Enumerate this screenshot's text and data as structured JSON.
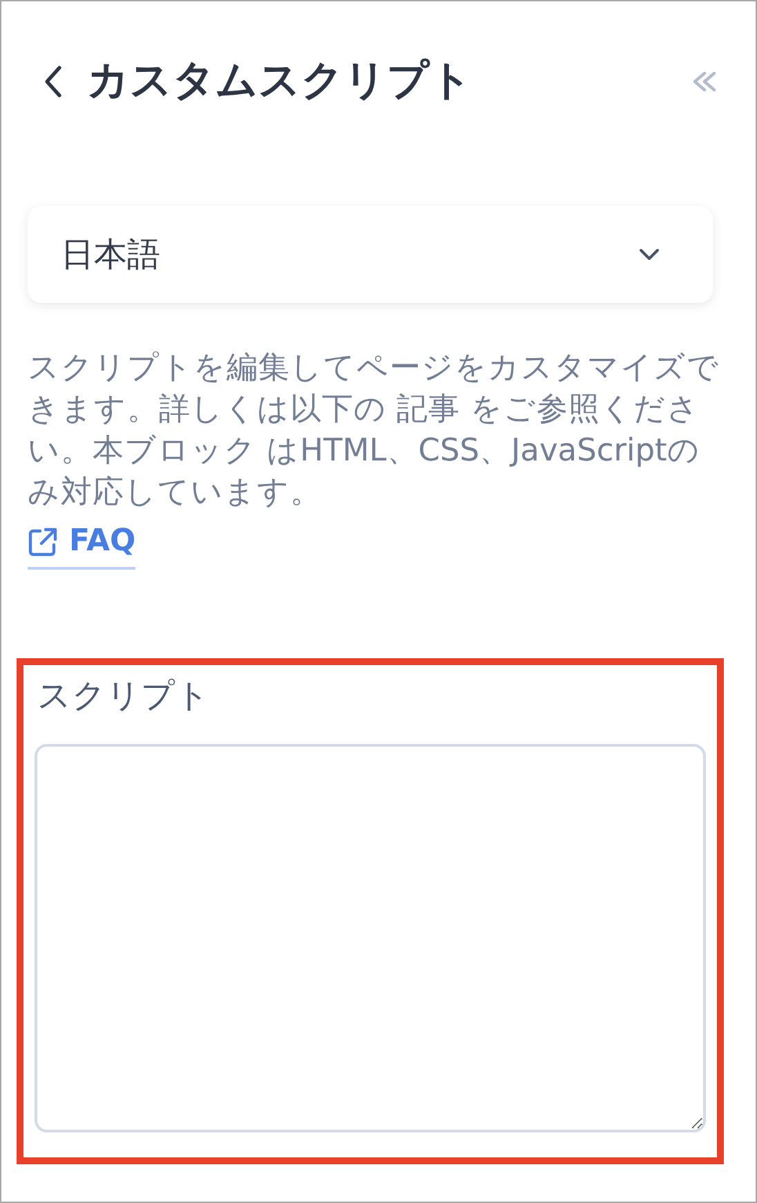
{
  "header": {
    "title": "カスタムスクリプト"
  },
  "language_select": {
    "value": "日本語"
  },
  "description": "スクリプトを編集してページをカスタマイズできます。詳しくは以下の 記事 をご参照ください。本ブロック はHTML、CSS、JavaScriptのみ対応しています。",
  "faq_link": {
    "label": "FAQ"
  },
  "script_field": {
    "label": "スクリプト",
    "highlighted": true
  }
}
